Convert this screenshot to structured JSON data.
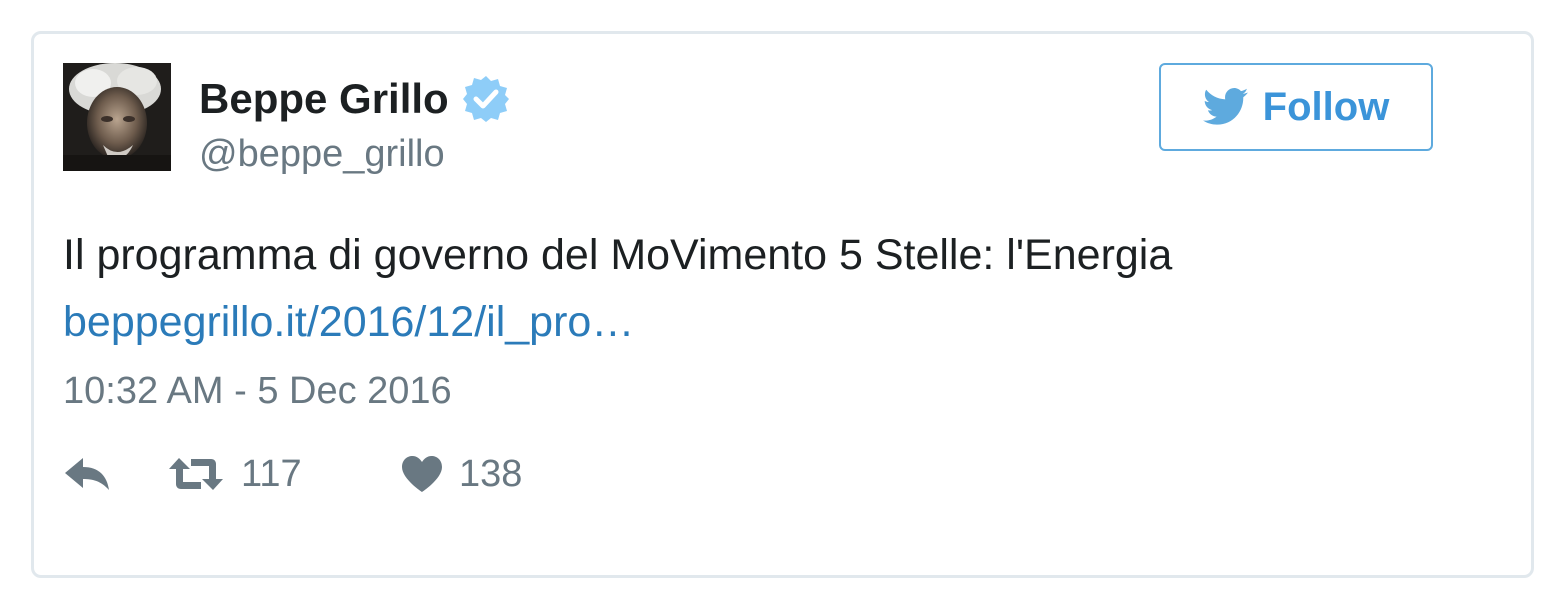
{
  "author": {
    "display_name": "Beppe Grillo",
    "handle": "@beppe_grillo",
    "verified": true,
    "verified_color": "#5eaade"
  },
  "follow_button": {
    "label": "Follow",
    "accent": "#3b94d9",
    "icon": "twitter-bird-icon"
  },
  "tweet": {
    "text": "Il programma di governo del MoVimento 5 Stelle: l'Energia",
    "link": "beppegrillo.it/2016/12/il_pro…",
    "link_color": "#2b7bb9",
    "timestamp": "10:32 AM - 5 Dec 2016"
  },
  "actions": {
    "reply": {
      "icon": "reply-icon"
    },
    "retweet": {
      "icon": "retweet-icon",
      "count": "117"
    },
    "like": {
      "icon": "heart-icon",
      "count": "138"
    }
  },
  "colors": {
    "text": "#1c2022",
    "muted": "#697882",
    "border": "#e1e8ed"
  }
}
